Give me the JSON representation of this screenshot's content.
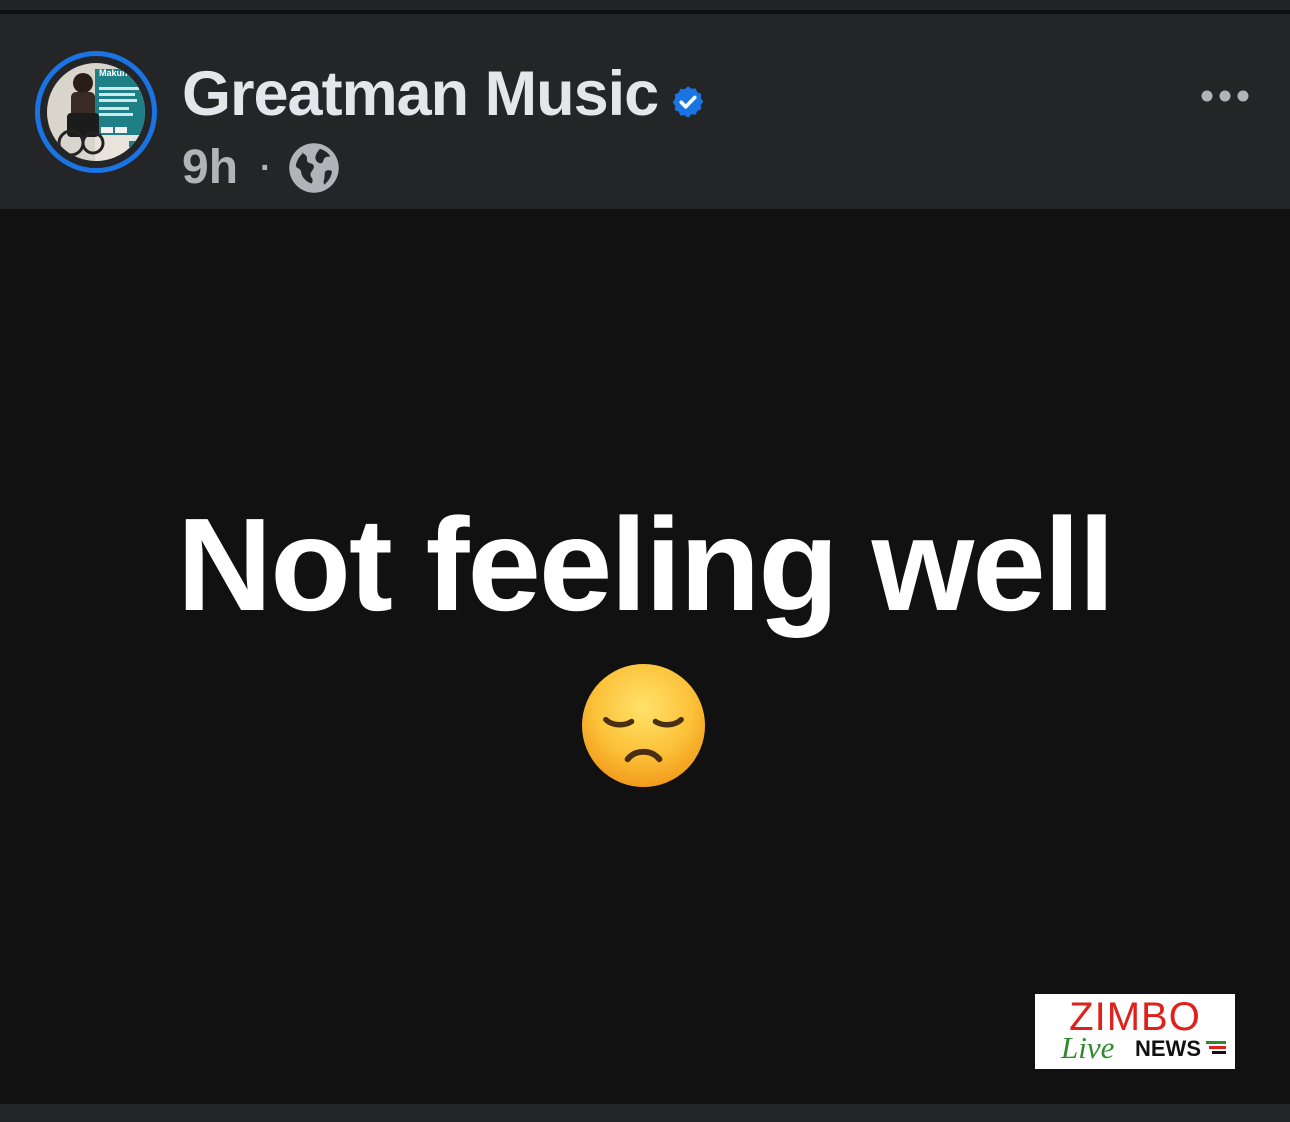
{
  "post": {
    "page_name": "Greatman Music",
    "timestamp": "9h",
    "separator": "·",
    "audience_icon": "globe-icon",
    "verified_icon": "verified-badge-icon",
    "more_icon": "more-options-icon",
    "text": "Not feeling well",
    "emoji": "disappointed-face-emoji"
  },
  "avatar": {
    "title_text": "Makun Kuvanho"
  },
  "watermark": {
    "line1": "ZIMBO",
    "line2": "Live",
    "line3": "NEWS"
  },
  "colors": {
    "header_bg": "#242526",
    "post_bg": "#111111",
    "accent_blue": "#1b74e4",
    "name_text": "#e4e6eb",
    "meta_text": "#b0b3b8"
  }
}
